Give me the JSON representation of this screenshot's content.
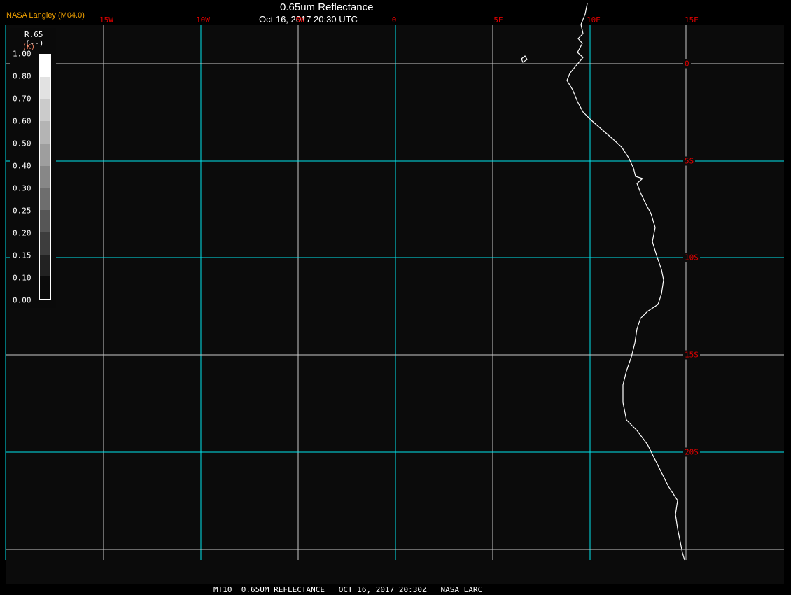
{
  "title": "0.65um Reflectance",
  "subtitle": "Oct 16, 2017 20:30 UTC",
  "credit": "NASA Langley (M04.0)",
  "footer": "MT10  0.65UM REFLECTANCE   OCT 16, 2017 20:30Z   NASA LARC",
  "lon_labels": [
    "15W",
    "10W",
    "5W",
    "0",
    "5E",
    "10E",
    "15E"
  ],
  "lat_labels": [
    "0",
    "5S",
    "10S",
    "15S",
    "20S"
  ],
  "legend": {
    "var": "R.65",
    "units": "(--)",
    "units2": "(K)",
    "ticks": [
      "1.00",
      "0.80",
      "0.70",
      "0.60",
      "0.50",
      "0.40",
      "0.30",
      "0.25",
      "0.20",
      "0.15",
      "0.10",
      "0.00"
    ],
    "colors": [
      "#0b0b0b",
      "#222222",
      "#3d3d3d",
      "#565656",
      "#6e6e6e",
      "#878787",
      "#9e9e9e",
      "#b4b4b4",
      "#cbcbcb",
      "#e2e2e2",
      "#ffffff"
    ]
  },
  "colors": {
    "grid_major": "#00e5ee",
    "grid_minor": "#c8c8c8",
    "coast": "#ffffff",
    "labels": "#e00000"
  }
}
